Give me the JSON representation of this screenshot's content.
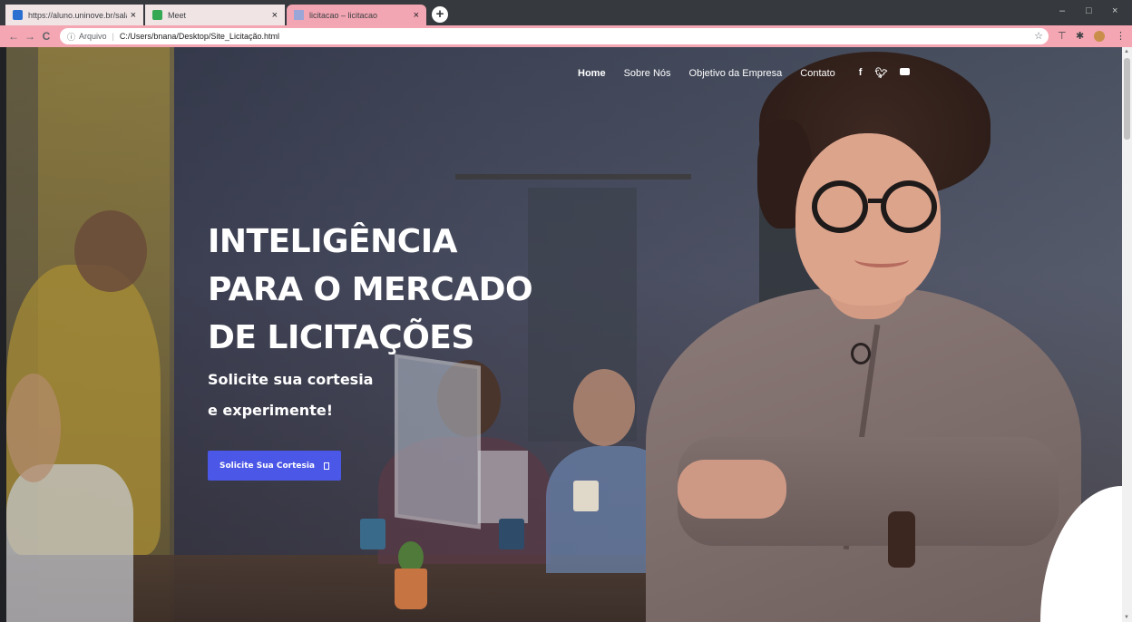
{
  "browser": {
    "tabs": [
      {
        "title": "https://aluno.uninove.br/sala_on",
        "active": false
      },
      {
        "title": "Meet",
        "active": false
      },
      {
        "title": "licitacao – licitacao",
        "active": true
      }
    ],
    "new_tab": "+",
    "close_glyph": "×",
    "address": {
      "info_icon": "info-icon",
      "scheme_label": "Arquivo",
      "path": "C:/Users/bnana/Desktop/Site_Licitação.html"
    },
    "nav_glyphs": {
      "back": "←",
      "forward": "→",
      "reload": "C"
    },
    "window_controls": {
      "minimize": "–",
      "maximize": "□",
      "close": "×"
    },
    "accent_color": "#f4a6b3"
  },
  "site": {
    "nav": {
      "items": [
        "Home",
        "Sobre Nós",
        "Objetivo da Empresa",
        "Contato"
      ],
      "social": [
        "f",
        "twitter-icon",
        "youtube-icon"
      ]
    },
    "hero": {
      "headline_lines": [
        "INTELIGÊNCIA",
        "PARA O MERCADO",
        "DE LICITAÇÕES"
      ],
      "sub_lines": [
        "Solicite sua cortesia",
        "e experimente!"
      ],
      "cta_label": "Solicite Sua Cortesia",
      "cta_color": "#4b57e6"
    }
  }
}
